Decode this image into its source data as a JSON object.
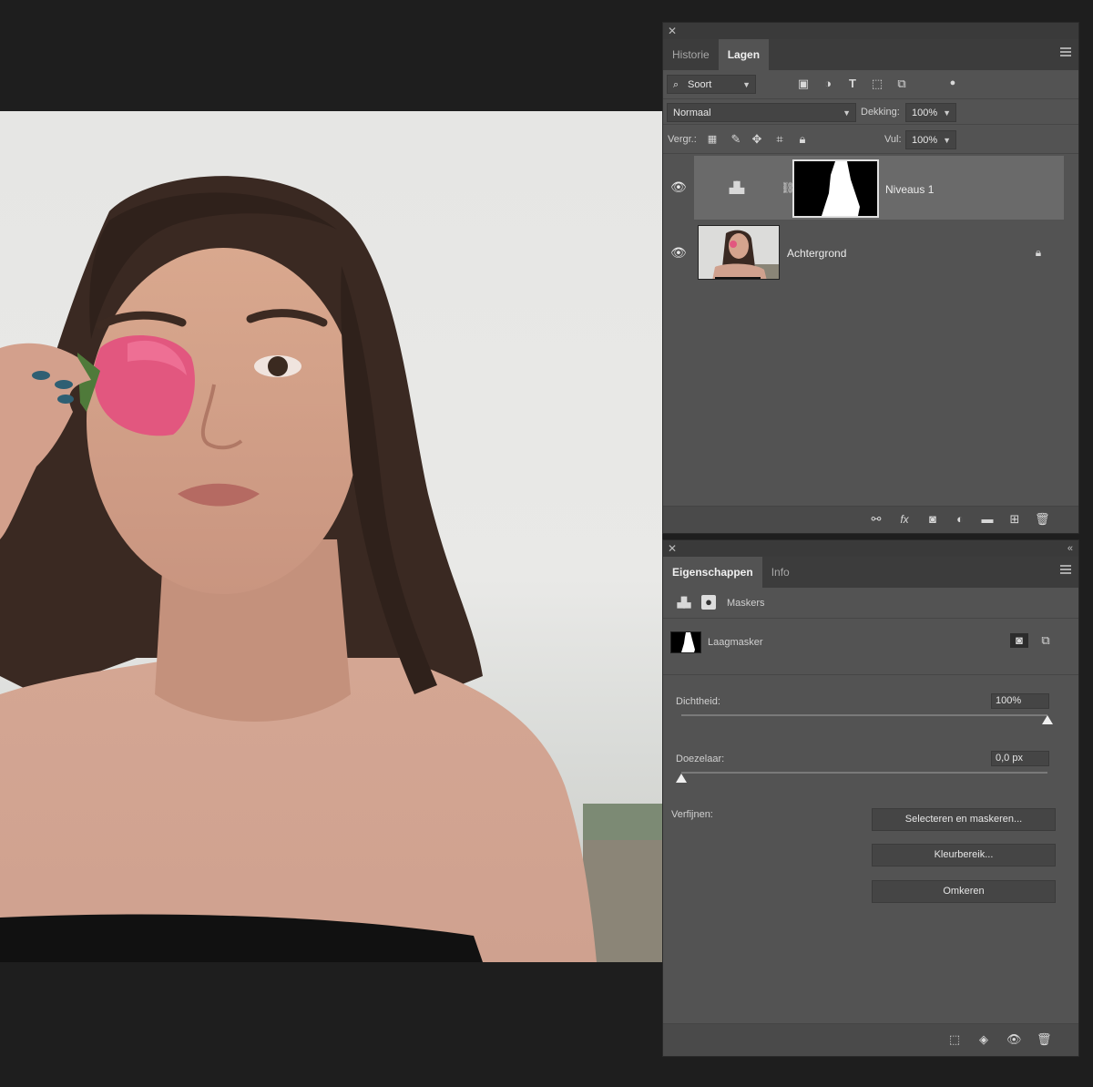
{
  "layers_panel": {
    "tabs": [
      "Historie",
      "Lagen"
    ],
    "active_tab": "Lagen",
    "filter": {
      "value": "Soort"
    },
    "blend_mode": "Normaal",
    "opacity_label": "Dekking:",
    "opacity_value": "100%",
    "lock_label": "Vergr.:",
    "fill_label": "Vul:",
    "fill_value": "100%",
    "layers": [
      {
        "name": "Niveaus 1",
        "type": "adjustment",
        "selected": true
      },
      {
        "name": "Achtergrond",
        "type": "background",
        "locked": true
      }
    ],
    "footer_icons": [
      "link-icon",
      "fx-icon",
      "mask-icon",
      "adjustment-icon",
      "folder-icon",
      "new-layer-icon",
      "trash-icon"
    ],
    "fx_label": "fx"
  },
  "properties_panel": {
    "tabs": [
      "Eigenschappen",
      "Info"
    ],
    "active_tab": "Eigenschappen",
    "mode_label": "Maskers",
    "mask_label": "Laagmasker",
    "density_label": "Dichtheid:",
    "density_value": "100%",
    "density_level": 1.0,
    "feather_label": "Doezelaar:",
    "feather_value": "0,0 px",
    "feather_level": 0.0,
    "refine_label": "Verfijnen:",
    "buttons": [
      "Selecteren en maskeren...",
      "Kleurbereik...",
      "Omkeren"
    ]
  },
  "colors": {
    "app_bg": "#1e1e1e",
    "panel_bg": "#535353",
    "selected_layer": "#6a6a6a"
  }
}
